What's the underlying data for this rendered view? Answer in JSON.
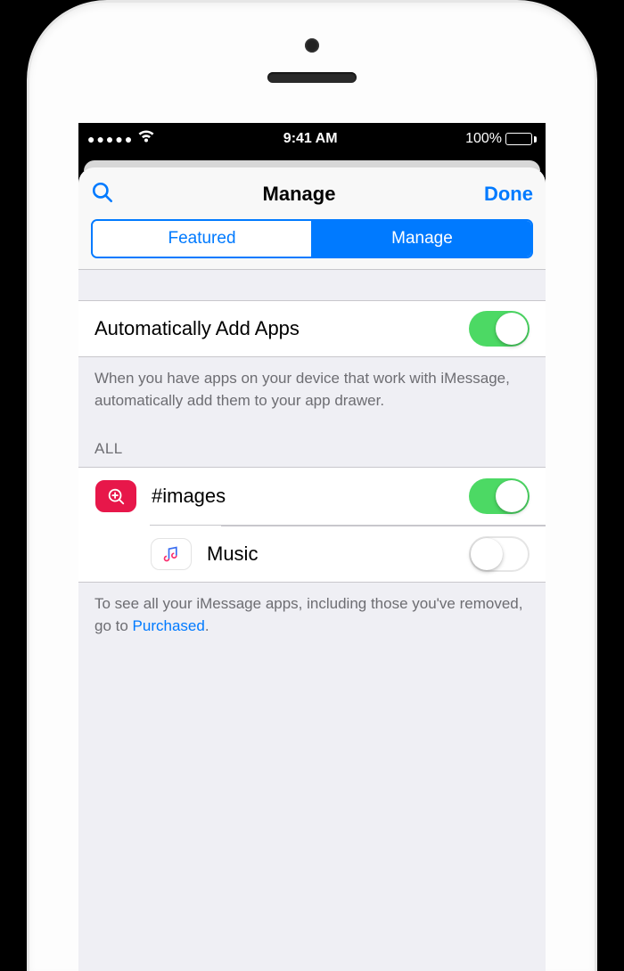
{
  "status": {
    "carrier_dots": "●●●●●",
    "time": "9:41 AM",
    "battery_pct": "100%"
  },
  "nav": {
    "title": "Manage",
    "done": "Done"
  },
  "segments": {
    "featured": "Featured",
    "manage": "Manage",
    "selected": "manage"
  },
  "auto_add": {
    "label": "Automatically Add Apps",
    "enabled": true,
    "footer": "When you have apps on your device that work with iMessage, automatically add them to your app drawer."
  },
  "all_section": {
    "header": "ALL",
    "items": [
      {
        "name": "#images",
        "enabled": true,
        "icon": "images"
      },
      {
        "name": "Music",
        "enabled": false,
        "icon": "music"
      }
    ],
    "footer_prefix": "To see all your iMessage apps, including those you've removed, go to ",
    "footer_link": "Purchased",
    "footer_suffix": "."
  }
}
